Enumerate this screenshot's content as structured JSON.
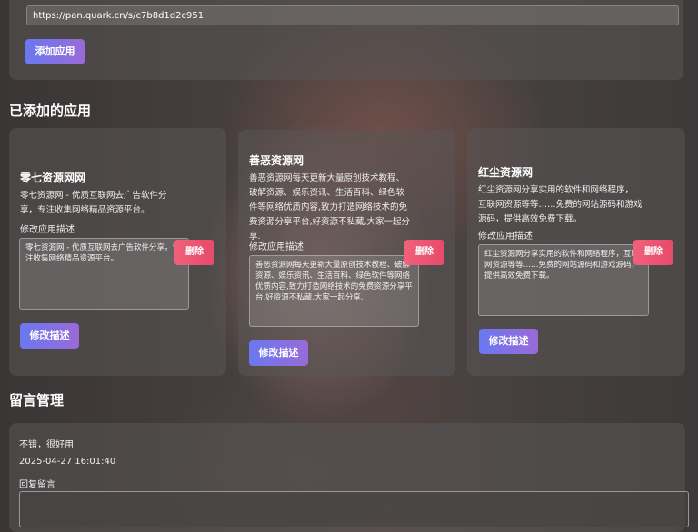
{
  "add_form": {
    "url_value": "https://pan.quark.cn/s/c7b8d1d2c951",
    "add_button": "添加应用"
  },
  "apps_section": {
    "title": "已添加的应用",
    "desc_label": "修改应用描述",
    "delete_label": "删除",
    "edit_label": "修改描述",
    "items": [
      {
        "name": "零七资源网网",
        "desc_lines": [
          "零七资源网 - 优质互联网去广告软件分",
          "享，专注收集网络精品资源平台。"
        ],
        "textarea_value": "零七资源网 - 优质互联网去广告软件分享，专注收集网络精品资源平台。"
      },
      {
        "name": "善恶资源网",
        "desc_lines": [
          "善恶资源网每天更新大量原创技术教程、",
          "破解资源、娱乐资讯、生活百科、绿色软",
          "件等网络优质内容,致力打造网络技术的免",
          "费资源分享平台,好资源不私藏,大家一起分",
          "享."
        ],
        "textarea_value": "善恶资源网每天更新大量原创技术教程、破解资源、娱乐资讯、生活百科、绿色软件等网络优质内容,致力打造网络技术的免费资源分享平台,好资源不私藏,大家一起分享."
      },
      {
        "name": "红尘资源网",
        "desc_lines": [
          "红尘资源网分享实用的软件和网络程序，",
          "互联网资源等等……免费的网站源码和游戏",
          "源码，提供高效免费下载。"
        ],
        "textarea_value": "红尘资源网分享实用的软件和网络程序，互联网资源等等……免费的网站源码和游戏源码，提供高效免费下载。"
      }
    ]
  },
  "messages_section": {
    "title": "留言管理",
    "message_text": "不错，很好用",
    "message_time": "2025-04-27 16:01:40",
    "reply_label": "回复留言"
  }
}
